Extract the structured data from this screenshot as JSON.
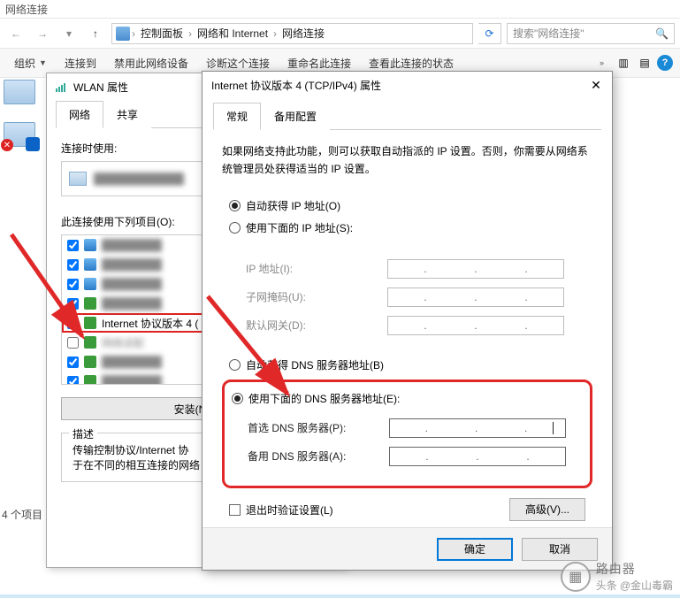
{
  "window": {
    "title": "网络连接"
  },
  "nav": {
    "crumbs": [
      "控制面板",
      "网络和 Internet",
      "网络连接"
    ],
    "search_placeholder": "搜索\"网络连接\""
  },
  "toolbar": {
    "org": "组织",
    "connect": "连接到",
    "disable": "禁用此网络设备",
    "diagnose": "诊断这个连接",
    "rename": "重命名此连接",
    "status": "查看此连接的状态"
  },
  "wlan": {
    "title": "WLAN 属性",
    "tab_network": "网络",
    "tab_share": "共享",
    "connect_using": "连接时使用:",
    "items_label": "此连接使用下列项目(O):",
    "items": [
      {
        "checked": true,
        "label": ""
      },
      {
        "checked": true,
        "label": ""
      },
      {
        "checked": true,
        "label": ""
      },
      {
        "checked": true,
        "label": ""
      },
      {
        "checked": true,
        "label": "Internet 协议版本 4 (",
        "sel": true
      },
      {
        "checked": false,
        "label": "网络适配"
      },
      {
        "checked": true,
        "label": ""
      },
      {
        "checked": true,
        "label": ""
      }
    ],
    "install": "安装(N)...",
    "desc_legend": "描述",
    "desc_text1": "传输控制协议/Internet 协",
    "desc_text2": "于在不同的相互连接的网络"
  },
  "ipv4": {
    "title": "Internet 协议版本 4 (TCP/IPv4) 属性",
    "tab_general": "常规",
    "tab_alt": "备用配置",
    "info": "如果网络支持此功能，则可以获取自动指派的 IP 设置。否则，你需要从网络系统管理员处获得适当的 IP 设置。",
    "auto_ip": "自动获得 IP 地址(O)",
    "use_ip": "使用下面的 IP 地址(S):",
    "ip_label": "IP 地址(I):",
    "mask_label": "子网掩码(U):",
    "gw_label": "默认网关(D):",
    "auto_dns": "自动获得 DNS 服务器地址(B)",
    "use_dns": "使用下面的 DNS 服务器地址(E):",
    "dns1_label": "首选 DNS 服务器(P):",
    "dns2_label": "备用 DNS 服务器(A):",
    "exit_validate": "退出时验证设置(L)",
    "advanced": "高级(V)...",
    "ok": "确定",
    "cancel": "取消"
  },
  "count": "4 个项目",
  "watermark": {
    "source": "头条",
    "author": "@金山毒霸",
    "brand": "路由器"
  }
}
